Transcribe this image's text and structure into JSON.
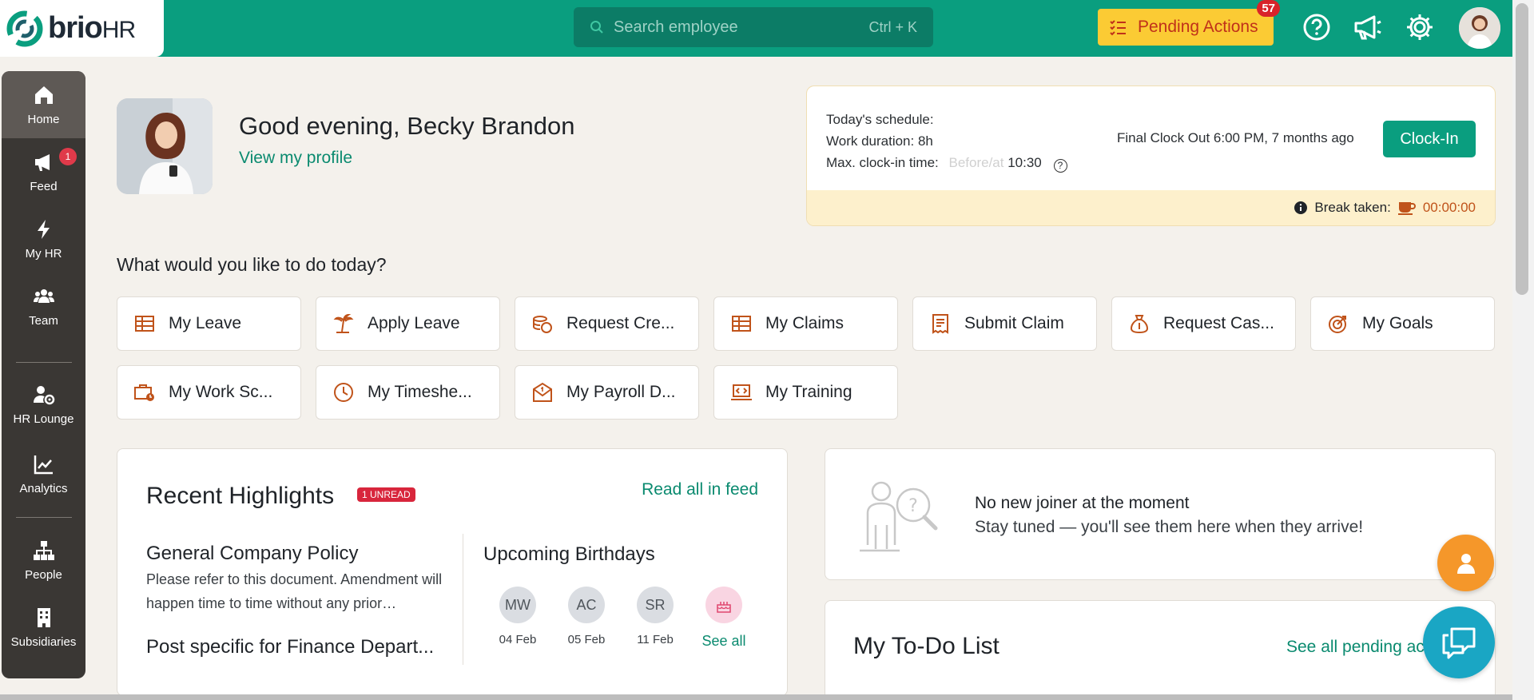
{
  "brand": {
    "name_bold": "brio",
    "name_light": "HR"
  },
  "search": {
    "placeholder": "Search employee",
    "shortcut": "Ctrl + K"
  },
  "pending": {
    "label": "Pending Actions",
    "count": "57"
  },
  "sidebar": {
    "items": [
      {
        "label": "Home"
      },
      {
        "label": "Feed",
        "badge": "1"
      },
      {
        "label": "My HR"
      },
      {
        "label": "Team"
      },
      {
        "label": "HR Lounge"
      },
      {
        "label": "Analytics"
      },
      {
        "label": "People"
      },
      {
        "label": "Subsidiaries"
      }
    ]
  },
  "profile": {
    "greeting": "Good evening, Becky Brandon",
    "view_profile": "View my profile"
  },
  "schedule": {
    "title": "Today's schedule:",
    "duration": "Work duration: 8h",
    "max_label": "Max. clock-in time:",
    "max_hint": "Before/at",
    "max_value": "10:30",
    "help": "?",
    "final_clock": "Final Clock Out 6:00 PM, 7 months ago",
    "clock_btn": "Clock-In",
    "break_label": "Break taken:",
    "break_time": "00:00:00"
  },
  "actions": {
    "title": "What would you like to do today?",
    "items": [
      {
        "label": "My Leave"
      },
      {
        "label": "Apply Leave"
      },
      {
        "label": "Request Cre..."
      },
      {
        "label": "My Claims"
      },
      {
        "label": "Submit Claim"
      },
      {
        "label": "Request Cas..."
      },
      {
        "label": "My Goals"
      },
      {
        "label": "My Work Sc..."
      },
      {
        "label": "My Timeshe..."
      },
      {
        "label": "My Payroll D..."
      },
      {
        "label": "My Training"
      }
    ]
  },
  "highlights": {
    "title": "Recent Highlights",
    "unread": "1 UNREAD",
    "read_all": "Read all in feed",
    "post1_title": "General Company Policy",
    "post1_body": "Please refer to this document. Amendment will happen time to time without any prior…",
    "post2_title": "Post specific for Finance Depart...",
    "birthdays_title": "Upcoming Birthdays",
    "birthdays": [
      {
        "initials": "MW",
        "date": "04 Feb"
      },
      {
        "initials": "AC",
        "date": "05 Feb"
      },
      {
        "initials": "SR",
        "date": "11 Feb"
      }
    ],
    "see_all": "See all"
  },
  "joiner": {
    "heading": "No new joiner at the moment",
    "sub": "Stay tuned — you'll see them here when they arrive!"
  },
  "todo": {
    "title": "My To-Do List",
    "link": "See all pending ac"
  },
  "colors": {
    "brand": "#0a9e7f",
    "pending": "#fbcb34",
    "accent_orange": "#c0531a",
    "sidebar": "#3a3734"
  }
}
